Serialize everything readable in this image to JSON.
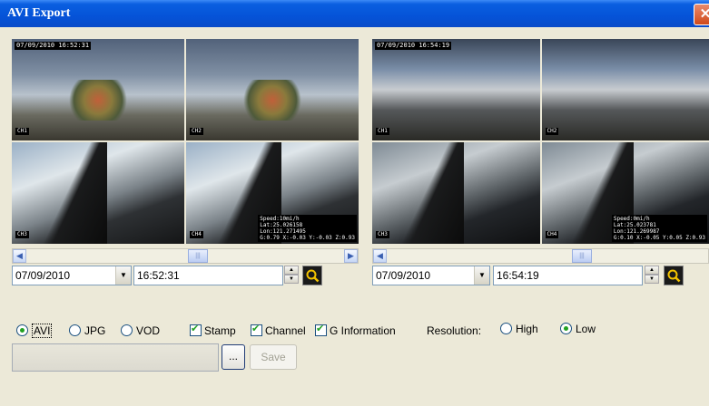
{
  "window": {
    "title": "AVI Export",
    "close_glyph": "✕"
  },
  "left_panel": {
    "overlay_time": "07/09/2010 16:52:31",
    "channels": [
      "CH1",
      "CH2",
      "CH3",
      "CH4"
    ],
    "gps": [
      "Speed:10mi/h",
      "Lat:25.026158",
      "Lon:121.271495",
      "G:0.79 X:-0.03 Y:-0.03 Z:0.93"
    ],
    "date": "07/09/2010",
    "time": "16:52:31"
  },
  "right_panel": {
    "overlay_time": "07/09/2010 16:54:19",
    "channels": [
      "CH1",
      "CH2",
      "CH3",
      "CH4"
    ],
    "gps": [
      "Speed:0mi/h",
      "Lat:25.023781",
      "Lon:121.269987",
      "G:0.10 X:-0.05 Y:0.05 Z:0.93"
    ],
    "date": "07/09/2010",
    "time": "16:54:19"
  },
  "format": {
    "avi": "AVI",
    "jpg": "JPG",
    "vod": "VOD",
    "selected": "AVI"
  },
  "checkboxes": {
    "stamp": "Stamp",
    "channel": "Channel",
    "ginfo": "G Information"
  },
  "resolution": {
    "label": "Resolution:",
    "high": "High",
    "low": "Low",
    "selected": "Low"
  },
  "output": {
    "path": "",
    "browse_label": "...",
    "save_label": "Save"
  },
  "colors": {
    "title_bar": "#0553d8",
    "dialog_bg": "#ece9d8",
    "radio_dot": "#21a121"
  }
}
